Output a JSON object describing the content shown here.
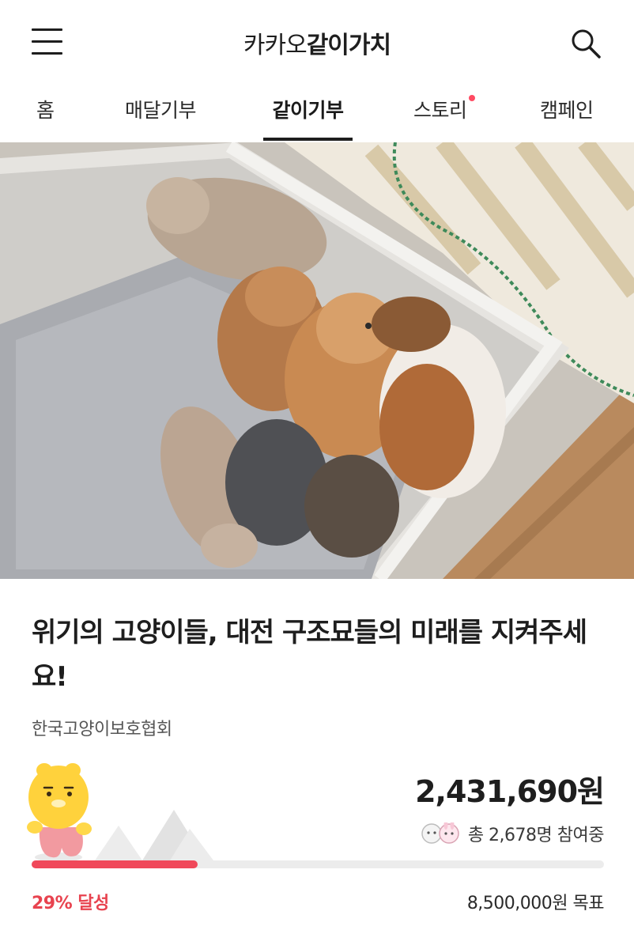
{
  "header": {
    "logo_light": "카카오",
    "logo_bold": "같이가치",
    "menu_icon": "hamburger-menu-icon",
    "search_icon": "search-icon"
  },
  "tabs": [
    {
      "label": "홈",
      "active": false
    },
    {
      "label": "매달기부",
      "active": false
    },
    {
      "label": "같이기부",
      "active": true
    },
    {
      "label": "스토리",
      "active": false,
      "new_dot": true
    },
    {
      "label": "캠페인",
      "active": false
    }
  ],
  "hero": {
    "image": "kittens-in-box-photo"
  },
  "campaign": {
    "title": "위기의 고양이들, 대전 구조묘들의 미래를 지켜주세요!",
    "organization": "한국고양이보호협회",
    "raised_amount": "2,431,690원",
    "participants_text": "총 2,678명 참여중",
    "progress_percent": 29,
    "progress_label": "29% 달성",
    "goal_text": "8,500,000원 목표"
  },
  "colors": {
    "accent": "#f0485a",
    "accent_text": "#e8434f",
    "new_dot": "#ff4a62",
    "track": "#ececec"
  }
}
